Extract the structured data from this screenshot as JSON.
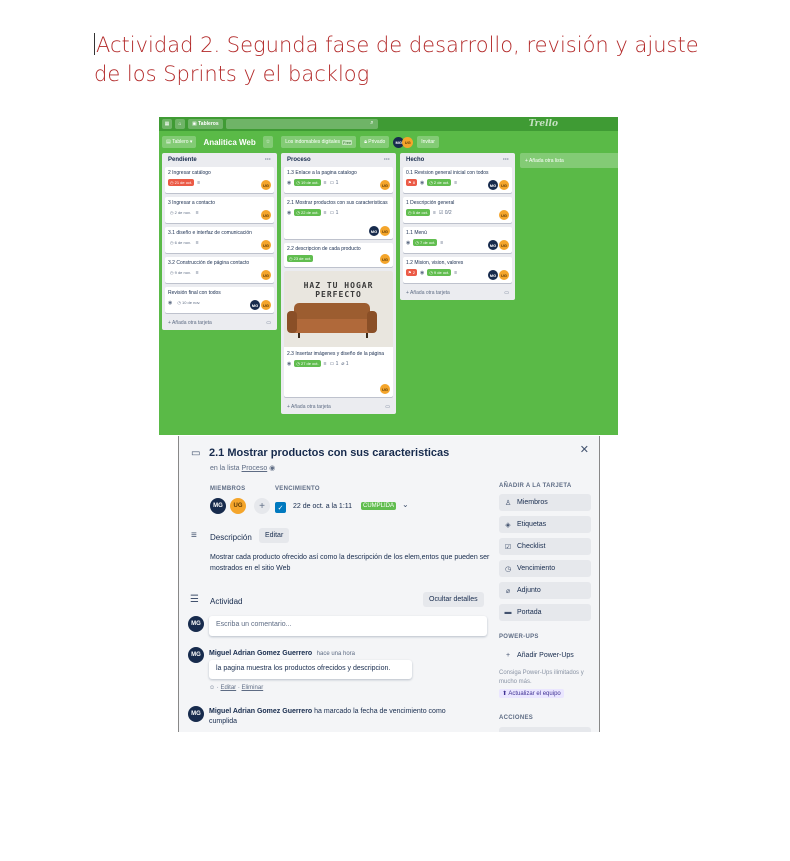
{
  "document": {
    "heading": "Actividad 2. Segunda fase de desarrollo, revisión y ajuste de los Sprints y el backlog"
  },
  "board": {
    "topbar": {
      "boards_label": "Tableros",
      "logo": "Trello"
    },
    "boardbar": {
      "board_menu": "Tablero",
      "board_name": "Analitica Web",
      "workspace": "Los indomables digitales",
      "workspace_tag": "Free",
      "visibility": "Privado",
      "invite": "Invitar"
    },
    "members": {
      "mg": "MG",
      "ug": "UG"
    },
    "add_list": "+ Añada otra lista",
    "add_card": "+ Añada otra tarjeta",
    "lists": [
      {
        "title": "Pendiente",
        "cards": [
          {
            "title": "2 Ingresar catálogo",
            "due": "21 de oct."
          },
          {
            "title": "3 Ingresar a contacto",
            "due": "2 de nov."
          },
          {
            "title": "3.1 diseño e interfaz de comunicación",
            "due": "6 de nov."
          },
          {
            "title": "3.2 Construcción de página contacto",
            "due": "9 de nov."
          },
          {
            "title": "Revisión final con todos",
            "due": "10 de nov."
          }
        ]
      },
      {
        "title": "Proceso",
        "cards": [
          {
            "title": "1.3 Enlace a la pagina catalogo",
            "due": "19 de oct.",
            "comments": "1"
          },
          {
            "title": "2.1 Mostrar productos con sus caracteristicas",
            "due": "22 de oct.",
            "comments": "1"
          },
          {
            "title": "2.2 descripcion de cada producto",
            "due": "23 de oct."
          },
          {
            "title": "2.3 Insertar imágenes y diseño de la página",
            "due": "27 de oct.",
            "comments": "1",
            "attachments": "1",
            "image_text": "HAZ TU HOGAR PERFECTO"
          }
        ]
      },
      {
        "title": "Hecho",
        "cards": [
          {
            "title": "0.1 Revision general inicial con todos",
            "count": "8",
            "due": "2 de oct."
          },
          {
            "title": "1 Descripción general",
            "due": "5 de oct.",
            "checklist": "0/2"
          },
          {
            "title": "1.1 Menú",
            "due": "7 de oct."
          },
          {
            "title": "1.2 Mision, vision, valores",
            "count": "2",
            "due": "9 de oct."
          }
        ]
      }
    ]
  },
  "card_detail": {
    "title": "2.1 Mostrar productos con sus caracteristicas",
    "in_list_prefix": "en la lista",
    "list_name": "Proceso",
    "members_label": "MIEMBROS",
    "due_label": "VENCIMIENTO",
    "due_value": "22 de oct. a la 1:11",
    "due_status": "CUMPLIDA",
    "description_label": "Descripción",
    "edit_label": "Editar",
    "description": "Mostrar cada producto ofrecido así como la descripción de los elem,entos que pueden ser mostrados en el sitio Web",
    "activity_label": "Actividad",
    "hide_details": "Ocultar detalles",
    "comment_placeholder": "Escriba un comentario...",
    "activity": [
      {
        "author": "Miguel Adrian Gomez Guerrero",
        "time": "hace una hora",
        "text": "la pagina muestra los productos ofrecidos y descripcion."
      },
      {
        "author": "Miguel Adrian Gomez Guerrero",
        "action": "ha marcado la fecha de vencimiento como cumplida"
      }
    ],
    "comment_actions": {
      "edit": "Editar",
      "delete": "Eliminar"
    },
    "sidebar": {
      "add_to_card": "AÑADIR A LA TARJETA",
      "buttons": [
        "Miembros",
        "Etiquetas",
        "Checklist",
        "Vencimiento",
        "Adjunto",
        "Portada"
      ],
      "powerups_label": "POWER-UPS",
      "add_powerups": "Añadir Power-Ups",
      "powerups_note": "Consiga Power-Ups ilimitados y mucho más.",
      "upgrade": "Actualizar el equipo",
      "actions_label": "ACCIONES"
    }
  }
}
